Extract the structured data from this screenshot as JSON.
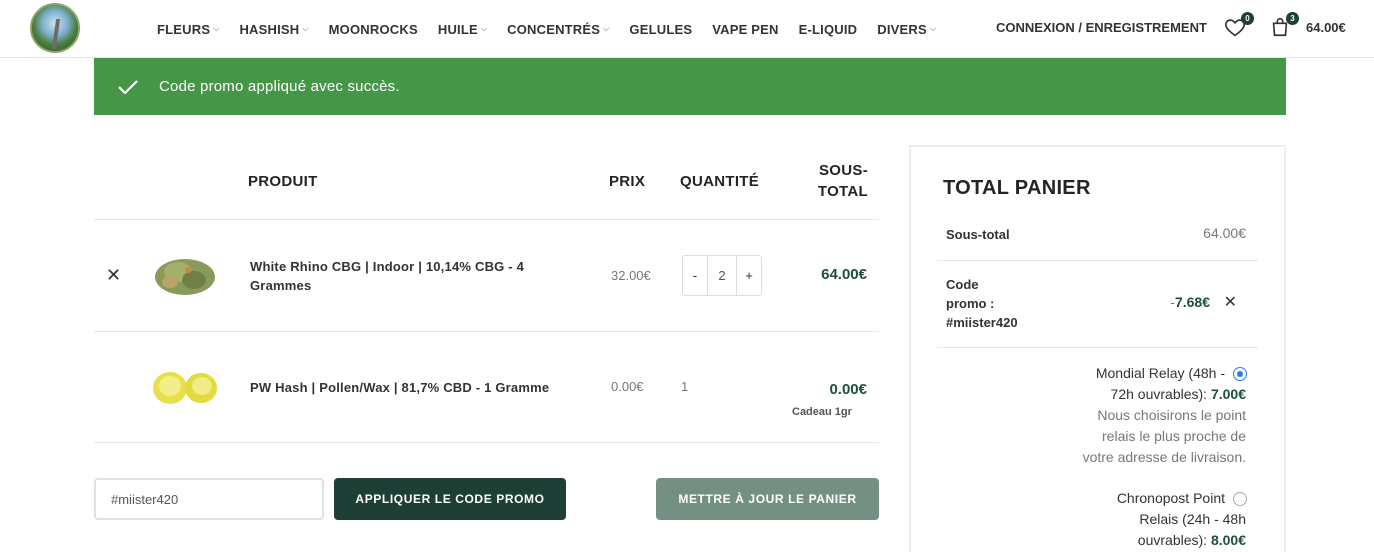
{
  "header": {
    "nav": [
      {
        "label": "FLEURS",
        "has_dropdown": true
      },
      {
        "label": "HASHISH",
        "has_dropdown": true
      },
      {
        "label": "MOONROCKS",
        "has_dropdown": false
      },
      {
        "label": "HUILE",
        "has_dropdown": true
      },
      {
        "label": "CONCENTRÉS",
        "has_dropdown": true
      },
      {
        "label": "GELULES",
        "has_dropdown": false
      },
      {
        "label": "VAPE PEN",
        "has_dropdown": false
      },
      {
        "label": "E-LIQUID",
        "has_dropdown": false
      },
      {
        "label": "DIVERS",
        "has_dropdown": true
      }
    ],
    "login": "CONNEXION / ENREGISTREMENT",
    "wishlist_count": "0",
    "cart_count": "3",
    "cart_total": "64.00€"
  },
  "notice": {
    "message": "Code promo appliqué avec succès."
  },
  "table": {
    "headers": {
      "product": "PRODUIT",
      "price": "PRIX",
      "quantity": "QUANTITÉ",
      "subtotal_line1": "SOUS-",
      "subtotal_line2": "TOTAL"
    },
    "rows": [
      {
        "name": "White Rhino CBG | Indoor | 10,14% CBG - 4 Grammes",
        "price": "32.00€",
        "qty": "2",
        "qty_minus": "-",
        "qty_plus": "+",
        "subtotal": "64.00€"
      },
      {
        "name": "PW Hash | Pollen/Wax | 81,7% CBD - 1 Gramme",
        "price": "0.00€",
        "qty": "1",
        "subtotal": "0.00€",
        "note": "Cadeau 1gr"
      }
    ]
  },
  "coupon": {
    "value": "#miister420",
    "apply_label": "APPLIQUER LE CODE PROMO",
    "update_label": "METTRE À JOUR LE PANIER"
  },
  "totals": {
    "title": "TOTAL PANIER",
    "subtotal_label": "Sous-total",
    "subtotal_value": "64.00€",
    "coupon_label_1": "Code",
    "coupon_label_2": "promo :",
    "coupon_label_3": "#miister420",
    "coupon_minus": "-",
    "coupon_value": "7.68€",
    "shipping": [
      {
        "line1": "Mondial Relay (48h -",
        "line2_pre": "72h ouvrables): ",
        "amount": "7.00€",
        "desc1": "Nous choisirons le point",
        "desc2": "relais le plus proche de",
        "desc3": "votre adresse de livraison.",
        "selected": true
      },
      {
        "line1": "Chronopost Point",
        "line2_pre": "Relais (24h - 48h",
        "line3_pre": "ouvrables): ",
        "amount": "8.00€",
        "selected": false
      }
    ]
  },
  "colors": {
    "accent_dark": "#1e3f36",
    "success": "#459647",
    "price_green": "#1e4e3f",
    "update_btn": "#739083"
  }
}
